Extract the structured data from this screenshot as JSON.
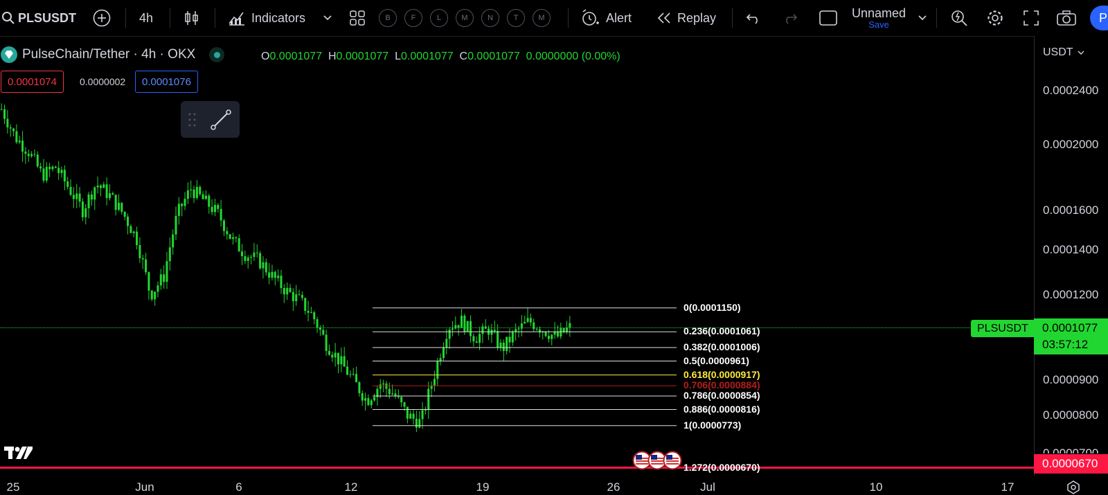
{
  "toolbar": {
    "symbol": "PLSUSDT",
    "interval": "4h",
    "indicators_label": "Indicators",
    "template_circles": [
      "B",
      "F",
      "L",
      "M",
      "N",
      "T",
      "M"
    ],
    "alert_label": "Alert",
    "replay_label": "Replay",
    "layout_name": "Unnamed",
    "save_label": "Save",
    "profile_initial": "P"
  },
  "legend": {
    "title": "PulseChain/Tether · 4h · OKX",
    "o_label": "O",
    "o": "0.0001077",
    "h_label": "H",
    "h": "0.0001077",
    "l_label": "L",
    "l": "0.0001077",
    "c_label": "C",
    "c": "0.0001077",
    "change": "0.0000000 (0.00%)"
  },
  "trade": {
    "sell": "0.0001074",
    "spread": "0.0000002",
    "buy": "0.0001076"
  },
  "price_axis": {
    "currency": "USDT",
    "ticks": [
      "0.0002400",
      "0.0002000",
      "0.0001600",
      "0.0001400",
      "0.0001200",
      "0.0000900",
      "0.0000800",
      "0.0000700"
    ],
    "symbol_tag": "PLSUSDT",
    "last_price": "0.0001077",
    "countdown": "03:57:12",
    "line_price": "0.0000670"
  },
  "time_axis": {
    "ticks": [
      "25",
      "Jun",
      "6",
      "12",
      "19",
      "26",
      "Jul",
      "10",
      "17"
    ]
  },
  "fib": [
    {
      "label": "0(0.0001150)",
      "price": 0.000115,
      "color": "#ffffff"
    },
    {
      "label": "0.236(0.0001061)",
      "price": 0.0001061,
      "color": "#ffffff"
    },
    {
      "label": "0.382(0.0001006)",
      "price": 0.0001006,
      "color": "#ffffff"
    },
    {
      "label": "0.5(0.0000961)",
      "price": 9.61e-05,
      "color": "#ffffff"
    },
    {
      "label": "0.618(0.0000917)",
      "price": 9.17e-05,
      "color": "#ffeb3b"
    },
    {
      "label": "0.706(0.0000884)",
      "price": 8.84e-05,
      "color": "#b71c1c"
    },
    {
      "label": "0.786(0.0000854)",
      "price": 8.54e-05,
      "color": "#ffffff"
    },
    {
      "label": "0.886(0.0000816)",
      "price": 8.16e-05,
      "color": "#ffffff"
    },
    {
      "label": "1(0.0000773)",
      "price": 7.73e-05,
      "color": "#ffffff"
    },
    {
      "label": "1.272(0.0000670)",
      "price": 6.7e-05,
      "color": "#ffffff"
    }
  ],
  "chart_data": {
    "type": "candlestick",
    "x_ticks": [
      "25",
      "Jun",
      "6",
      "12",
      "19",
      "26",
      "Jul",
      "10",
      "17"
    ],
    "y_scale": "log",
    "y_ticks": [
      0.00024,
      0.0002,
      0.00016,
      0.00014,
      0.00012,
      9e-05,
      8e-05,
      7e-05
    ],
    "close_path": [
      0.000225,
      0.000205,
      0.000195,
      0.00018,
      0.000185,
      0.000172,
      0.00016,
      0.000175,
      0.000168,
      0.000158,
      0.000145,
      0.00012,
      0.000128,
      0.000158,
      0.000172,
      0.000165,
      0.000158,
      0.000145,
      0.000138,
      0.000135,
      0.000128,
      0.000122,
      0.000118,
      0.000112,
      0.000102,
      9.6e-05,
      9e-05,
      8.4e-05,
      8.9e-05,
      8.6e-05,
      8e-05,
      7.8e-05,
      9.2e-05,
      0.000108,
      0.00011,
      0.000104,
      0.000107,
      0.0001,
      0.000106,
      0.00011,
      0.000107,
      0.000104,
      0.0001077
    ],
    "colors": {
      "up": "#22d631",
      "down": "#22d631",
      "price_line": "#ff1744"
    }
  }
}
